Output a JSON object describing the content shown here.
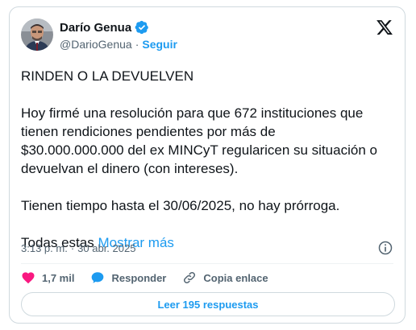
{
  "author": {
    "display_name": "Darío Genua",
    "handle": "@DarioGenua",
    "separator": "·",
    "follow_label": "Seguir",
    "verified": true
  },
  "tweet": {
    "paragraphs": [
      "RINDEN O LA DEVUELVEN",
      "Hoy firmé una resolución para que 672 instituciones que\ntienen rendiciones pendientes por más de\n$30.000.000.000 del ex MINCyT regularicen su situación o\ndevuelvan el dinero (con intereses).",
      "Tienen tiempo hasta el 30/06/2025, no hay prórroga."
    ],
    "truncated_text": "Todas estas ",
    "show_more_label": "Mostrar más"
  },
  "meta": {
    "time": "3:13 p. m.",
    "separator": "·",
    "date": "30 abr. 2025"
  },
  "actions": {
    "likes": "1,7 mil",
    "reply_label": "Responder",
    "copy_link_label": "Copia enlace"
  },
  "read_replies_label": "Leer 195 respuestas",
  "colors": {
    "accent": "#1d9bf0",
    "like": "#f91880",
    "text": "#0f1419",
    "secondary": "#536471",
    "border": "#cfd9de"
  },
  "icons": [
    "verified-badge-icon",
    "x-logo-icon",
    "info-icon",
    "heart-icon",
    "reply-bubble-icon",
    "link-icon"
  ]
}
